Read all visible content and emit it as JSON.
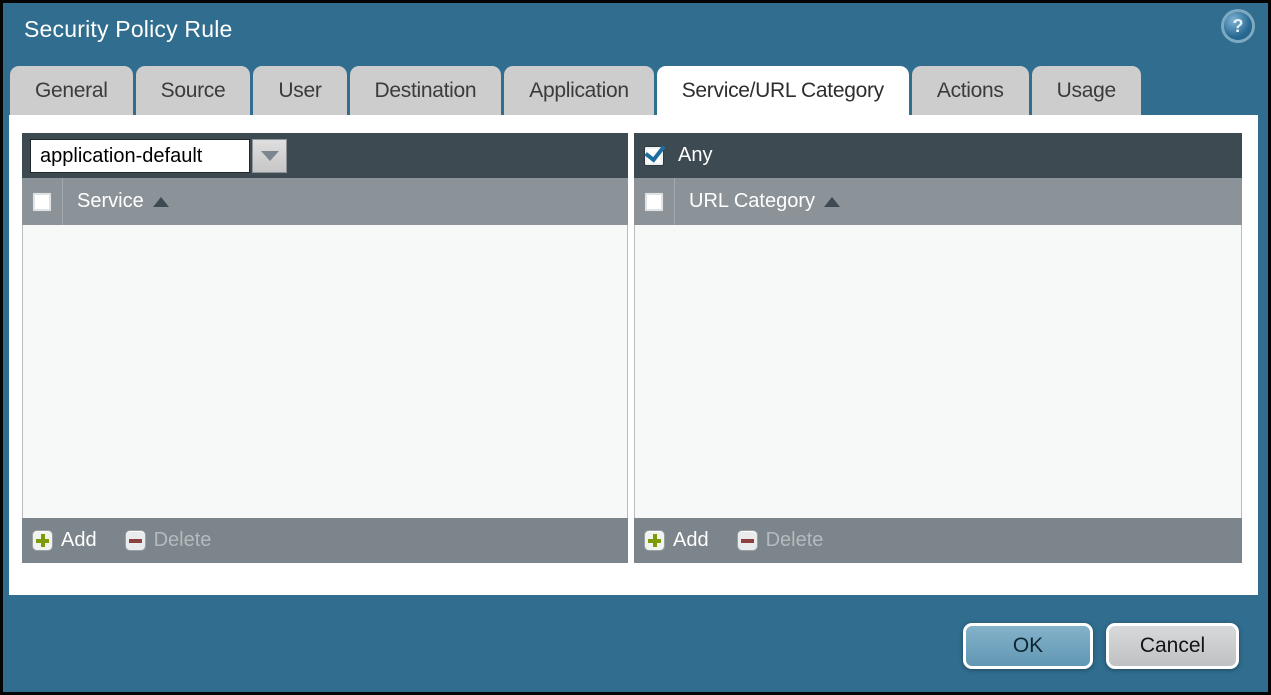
{
  "window": {
    "title": "Security Policy Rule"
  },
  "tabs": [
    {
      "label": "General",
      "active": false
    },
    {
      "label": "Source",
      "active": false
    },
    {
      "label": "User",
      "active": false
    },
    {
      "label": "Destination",
      "active": false
    },
    {
      "label": "Application",
      "active": false
    },
    {
      "label": "Service/URL Category",
      "active": true
    },
    {
      "label": "Actions",
      "active": false
    },
    {
      "label": "Usage",
      "active": false
    }
  ],
  "service_panel": {
    "dropdown": {
      "value": "application-default"
    },
    "select_all_checked": false,
    "column_header": "Service",
    "sort": "asc",
    "rows": [],
    "toolbar": {
      "add_label": "Add",
      "delete_label": "Delete",
      "delete_enabled": false
    }
  },
  "url_category_panel": {
    "any_label": "Any",
    "any_checked": true,
    "select_all_checked": false,
    "column_header": "URL Category",
    "sort": "asc",
    "rows": [],
    "toolbar": {
      "add_label": "Add",
      "delete_label": "Delete",
      "delete_enabled": false
    }
  },
  "dialog_buttons": {
    "ok_label": "OK",
    "cancel_label": "Cancel"
  },
  "icons": {
    "help": "question-mark",
    "dropdown_arrow": "chevron-down",
    "sort": "triangle-up",
    "add": "plus",
    "delete": "minus",
    "any_check": "checkmark"
  },
  "colors": {
    "titlebar_teal": "#306d8e",
    "tab_inactive_gray": "#cdcdcd",
    "tab_active_white": "#ffffff",
    "panel_topbar_dark": "#3e4a52",
    "column_header_gray": "#8b9399",
    "list_body_gray": "#f7f8f8",
    "toolbar_gray": "#7c858b",
    "add_plus_green": "#7d9b08",
    "delete_minus_red": "#8c4040",
    "checkmark_blue": "#1d6da0",
    "ok_button_blue": "#6fa2bd",
    "cancel_button_gray": "#c9cbcd"
  }
}
